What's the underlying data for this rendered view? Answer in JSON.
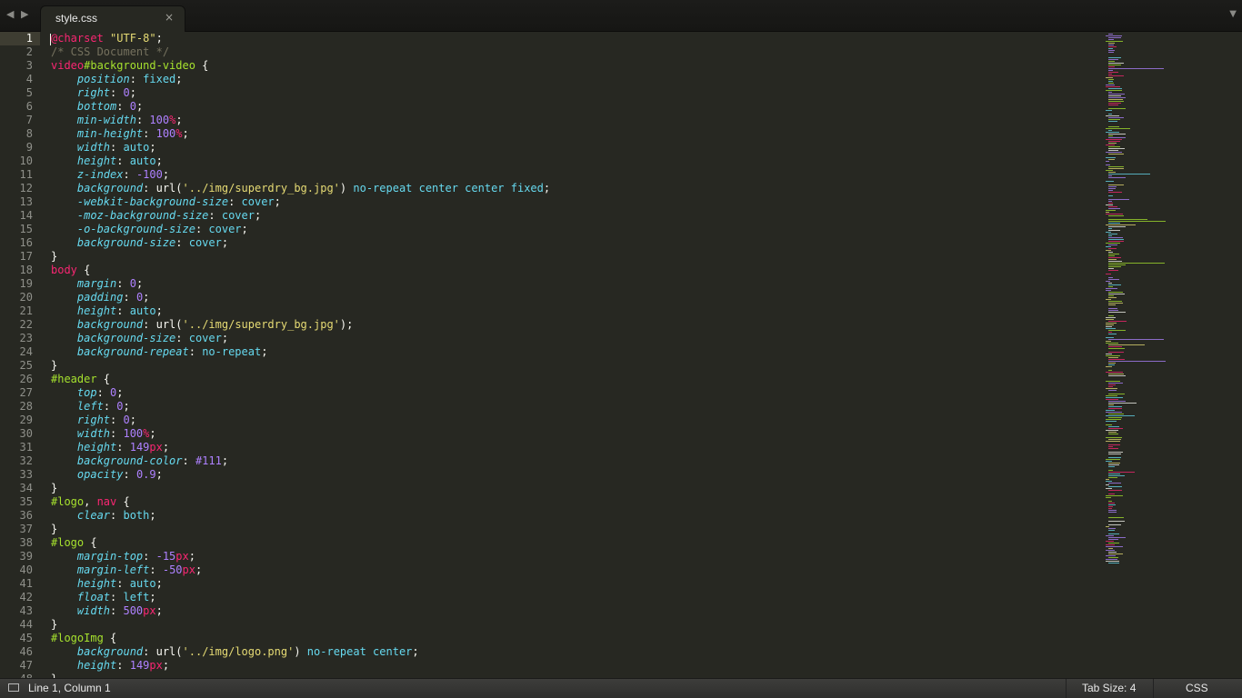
{
  "tab": {
    "name": "style.css",
    "close_glyph": "×"
  },
  "nav": {
    "back_glyph": "◀",
    "forward_glyph": "▶",
    "menu_glyph": "▼"
  },
  "status": {
    "position": "Line 1, Column 1",
    "tab_size": "Tab Size: 4",
    "syntax": "CSS"
  },
  "active_line": 1,
  "code_lines": [
    [
      [
        "@charset",
        "at"
      ],
      [
        " ",
        "p"
      ],
      [
        "\"UTF-8\"",
        "str"
      ],
      [
        ";",
        "p"
      ]
    ],
    [
      [
        "/* CSS Document */",
        "com"
      ]
    ],
    [
      [
        "video",
        "tag"
      ],
      [
        "#background-video",
        "sel"
      ],
      [
        " {",
        "p"
      ]
    ],
    [
      [
        "    ",
        "p"
      ],
      [
        "position",
        "prop"
      ],
      [
        ": ",
        "p"
      ],
      [
        "fixed",
        "val"
      ],
      [
        ";",
        "p"
      ]
    ],
    [
      [
        "    ",
        "p"
      ],
      [
        "right",
        "prop"
      ],
      [
        ": ",
        "p"
      ],
      [
        "0",
        "num"
      ],
      [
        ";",
        "p"
      ]
    ],
    [
      [
        "    ",
        "p"
      ],
      [
        "bottom",
        "prop"
      ],
      [
        ": ",
        "p"
      ],
      [
        "0",
        "num"
      ],
      [
        ";",
        "p"
      ]
    ],
    [
      [
        "    ",
        "p"
      ],
      [
        "min-width",
        "prop"
      ],
      [
        ": ",
        "p"
      ],
      [
        "100",
        "num"
      ],
      [
        "%",
        "unit"
      ],
      [
        ";",
        "p"
      ]
    ],
    [
      [
        "    ",
        "p"
      ],
      [
        "min-height",
        "prop"
      ],
      [
        ": ",
        "p"
      ],
      [
        "100",
        "num"
      ],
      [
        "%",
        "unit"
      ],
      [
        ";",
        "p"
      ]
    ],
    [
      [
        "    ",
        "p"
      ],
      [
        "width",
        "prop"
      ],
      [
        ": ",
        "p"
      ],
      [
        "auto",
        "val"
      ],
      [
        ";",
        "p"
      ]
    ],
    [
      [
        "    ",
        "p"
      ],
      [
        "height",
        "prop"
      ],
      [
        ": ",
        "p"
      ],
      [
        "auto",
        "val"
      ],
      [
        ";",
        "p"
      ]
    ],
    [
      [
        "    ",
        "p"
      ],
      [
        "z-index",
        "prop"
      ],
      [
        ": ",
        "p"
      ],
      [
        "-100",
        "num"
      ],
      [
        ";",
        "p"
      ]
    ],
    [
      [
        "    ",
        "p"
      ],
      [
        "background",
        "prop"
      ],
      [
        ": ",
        "p"
      ],
      [
        "url(",
        "fn"
      ],
      [
        "'../img/superdry_bg.jpg'",
        "str"
      ],
      [
        ")",
        "fn"
      ],
      [
        " no-repeat center center fixed",
        "val"
      ],
      [
        ";",
        "p"
      ]
    ],
    [
      [
        "    ",
        "p"
      ],
      [
        "-webkit-background-size",
        "prop"
      ],
      [
        ": ",
        "p"
      ],
      [
        "cover",
        "val"
      ],
      [
        ";",
        "p"
      ]
    ],
    [
      [
        "    ",
        "p"
      ],
      [
        "-moz-background-size",
        "prop"
      ],
      [
        ": ",
        "p"
      ],
      [
        "cover",
        "val"
      ],
      [
        ";",
        "p"
      ]
    ],
    [
      [
        "    ",
        "p"
      ],
      [
        "-o-background-size",
        "prop"
      ],
      [
        ": ",
        "p"
      ],
      [
        "cover",
        "val"
      ],
      [
        ";",
        "p"
      ]
    ],
    [
      [
        "    ",
        "p"
      ],
      [
        "background-size",
        "prop"
      ],
      [
        ": ",
        "p"
      ],
      [
        "cover",
        "val"
      ],
      [
        ";",
        "p"
      ]
    ],
    [
      [
        "}",
        "p"
      ]
    ],
    [
      [
        "body",
        "tag"
      ],
      [
        " {",
        "p"
      ]
    ],
    [
      [
        "    ",
        "p"
      ],
      [
        "margin",
        "prop"
      ],
      [
        ": ",
        "p"
      ],
      [
        "0",
        "num"
      ],
      [
        ";",
        "p"
      ]
    ],
    [
      [
        "    ",
        "p"
      ],
      [
        "padding",
        "prop"
      ],
      [
        ": ",
        "p"
      ],
      [
        "0",
        "num"
      ],
      [
        ";",
        "p"
      ]
    ],
    [
      [
        "    ",
        "p"
      ],
      [
        "height",
        "prop"
      ],
      [
        ": ",
        "p"
      ],
      [
        "auto",
        "val"
      ],
      [
        ";",
        "p"
      ]
    ],
    [
      [
        "    ",
        "p"
      ],
      [
        "background",
        "prop"
      ],
      [
        ": ",
        "p"
      ],
      [
        "url(",
        "fn"
      ],
      [
        "'../img/superdry_bg.jpg'",
        "str"
      ],
      [
        ")",
        "fn"
      ],
      [
        ";",
        "p"
      ]
    ],
    [
      [
        "    ",
        "p"
      ],
      [
        "background-size",
        "prop"
      ],
      [
        ": ",
        "p"
      ],
      [
        "cover",
        "val"
      ],
      [
        ";",
        "p"
      ]
    ],
    [
      [
        "    ",
        "p"
      ],
      [
        "background-repeat",
        "prop"
      ],
      [
        ": ",
        "p"
      ],
      [
        "no-repeat",
        "val"
      ],
      [
        ";",
        "p"
      ]
    ],
    [
      [
        "}",
        "p"
      ]
    ],
    [
      [
        "#header",
        "sel"
      ],
      [
        " {",
        "p"
      ]
    ],
    [
      [
        "    ",
        "p"
      ],
      [
        "top",
        "prop"
      ],
      [
        ": ",
        "p"
      ],
      [
        "0",
        "num"
      ],
      [
        ";",
        "p"
      ]
    ],
    [
      [
        "    ",
        "p"
      ],
      [
        "left",
        "prop"
      ],
      [
        ": ",
        "p"
      ],
      [
        "0",
        "num"
      ],
      [
        ";",
        "p"
      ]
    ],
    [
      [
        "    ",
        "p"
      ],
      [
        "right",
        "prop"
      ],
      [
        ": ",
        "p"
      ],
      [
        "0",
        "num"
      ],
      [
        ";",
        "p"
      ]
    ],
    [
      [
        "    ",
        "p"
      ],
      [
        "width",
        "prop"
      ],
      [
        ": ",
        "p"
      ],
      [
        "100",
        "num"
      ],
      [
        "%",
        "unit"
      ],
      [
        ";",
        "p"
      ]
    ],
    [
      [
        "    ",
        "p"
      ],
      [
        "height",
        "prop"
      ],
      [
        ": ",
        "p"
      ],
      [
        "149",
        "num"
      ],
      [
        "px",
        "unit"
      ],
      [
        ";",
        "p"
      ]
    ],
    [
      [
        "    ",
        "p"
      ],
      [
        "background-color",
        "prop"
      ],
      [
        ": ",
        "p"
      ],
      [
        "#111",
        "num"
      ],
      [
        ";",
        "p"
      ]
    ],
    [
      [
        "    ",
        "p"
      ],
      [
        "opacity",
        "prop"
      ],
      [
        ": ",
        "p"
      ],
      [
        "0.9",
        "num"
      ],
      [
        ";",
        "p"
      ]
    ],
    [
      [
        "}",
        "p"
      ]
    ],
    [
      [
        "#logo",
        "sel"
      ],
      [
        ", ",
        "p"
      ],
      [
        "nav",
        "tag"
      ],
      [
        " {",
        "p"
      ]
    ],
    [
      [
        "    ",
        "p"
      ],
      [
        "clear",
        "prop"
      ],
      [
        ": ",
        "p"
      ],
      [
        "both",
        "val"
      ],
      [
        ";",
        "p"
      ]
    ],
    [
      [
        "}",
        "p"
      ]
    ],
    [
      [
        "#logo",
        "sel"
      ],
      [
        " {",
        "p"
      ]
    ],
    [
      [
        "    ",
        "p"
      ],
      [
        "margin-top",
        "prop"
      ],
      [
        ": ",
        "p"
      ],
      [
        "-15",
        "num"
      ],
      [
        "px",
        "unit"
      ],
      [
        ";",
        "p"
      ]
    ],
    [
      [
        "    ",
        "p"
      ],
      [
        "margin-left",
        "prop"
      ],
      [
        ": ",
        "p"
      ],
      [
        "-50",
        "num"
      ],
      [
        "px",
        "unit"
      ],
      [
        ";",
        "p"
      ]
    ],
    [
      [
        "    ",
        "p"
      ],
      [
        "height",
        "prop"
      ],
      [
        ": ",
        "p"
      ],
      [
        "auto",
        "val"
      ],
      [
        ";",
        "p"
      ]
    ],
    [
      [
        "    ",
        "p"
      ],
      [
        "float",
        "prop"
      ],
      [
        ": ",
        "p"
      ],
      [
        "left",
        "val"
      ],
      [
        ";",
        "p"
      ]
    ],
    [
      [
        "    ",
        "p"
      ],
      [
        "width",
        "prop"
      ],
      [
        ": ",
        "p"
      ],
      [
        "500",
        "num"
      ],
      [
        "px",
        "unit"
      ],
      [
        ";",
        "p"
      ]
    ],
    [
      [
        "}",
        "p"
      ]
    ],
    [
      [
        "#logoImg",
        "sel"
      ],
      [
        " {",
        "p"
      ]
    ],
    [
      [
        "    ",
        "p"
      ],
      [
        "background",
        "prop"
      ],
      [
        ": ",
        "p"
      ],
      [
        "url(",
        "fn"
      ],
      [
        "'../img/logo.png'",
        "str"
      ],
      [
        ")",
        "fn"
      ],
      [
        " no-repeat center",
        "val"
      ],
      [
        ";",
        "p"
      ]
    ],
    [
      [
        "    ",
        "p"
      ],
      [
        "height",
        "prop"
      ],
      [
        ": ",
        "p"
      ],
      [
        "149",
        "num"
      ],
      [
        "px",
        "unit"
      ],
      [
        ";",
        "p"
      ]
    ],
    [
      [
        "}",
        "p"
      ]
    ]
  ],
  "colors": {
    "background": "#272822",
    "foreground": "#f8f8f2",
    "keyword": "#f92672",
    "selector": "#a6e22e",
    "property": "#66d9ef",
    "number": "#ae81ff",
    "string": "#e6db74",
    "comment": "#75715e"
  }
}
